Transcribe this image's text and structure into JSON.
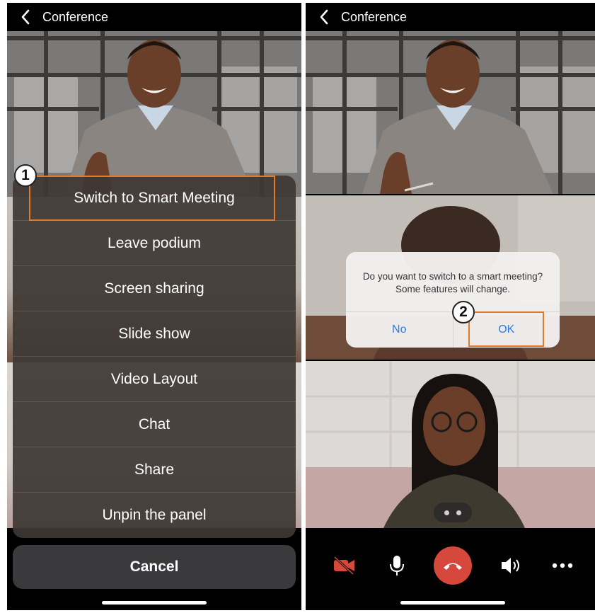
{
  "left_panel": {
    "title": "Conference",
    "step_number": "1",
    "menu_items": [
      "Switch to Smart Meeting",
      "Leave podium",
      "Screen sharing",
      "Slide show",
      "Video Layout",
      "Chat",
      "Share",
      "Unpin the panel"
    ],
    "cancel_label": "Cancel"
  },
  "right_panel": {
    "title": "Conference",
    "step_number": "2",
    "dialog": {
      "message": "Do you want to switch to a smart meeting? Some features will change.",
      "no_label": "No",
      "ok_label": "OK"
    },
    "call_controls": [
      "camera-off-icon",
      "microphone-icon",
      "end-call-icon",
      "speaker-icon",
      "more-icon"
    ]
  },
  "colors": {
    "highlight": "#e07a2a",
    "end_call": "#d6473c",
    "camera_off": "#d6473c",
    "dialog_button": "#2b7de9"
  }
}
